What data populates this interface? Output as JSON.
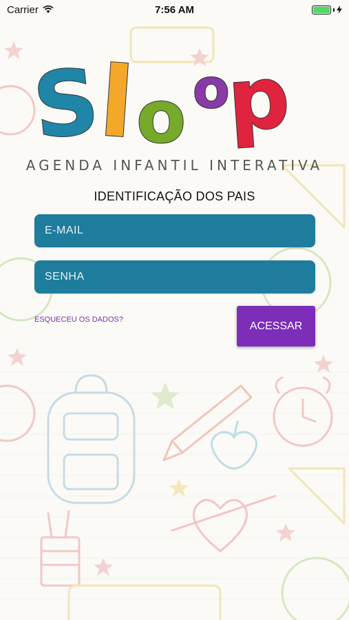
{
  "status_bar": {
    "carrier": "Carrier",
    "time": "7:56 AM"
  },
  "logo": {
    "letters": [
      "S",
      "l",
      "o",
      "o",
      "p"
    ],
    "tagline": "AGENDA INFANTIL INTERATIVA"
  },
  "form": {
    "title": "IDENTIFICAÇÃO DOS PAIS",
    "email_placeholder": "E-MAIL",
    "password_placeholder": "SENHA",
    "forgot_label": "ESQUECEU OS DADOS?",
    "submit_label": "ACESSAR"
  },
  "colors": {
    "field_bg": "#1e7c9c",
    "button_bg": "#7c2eb9",
    "link": "#7b2fb3"
  }
}
